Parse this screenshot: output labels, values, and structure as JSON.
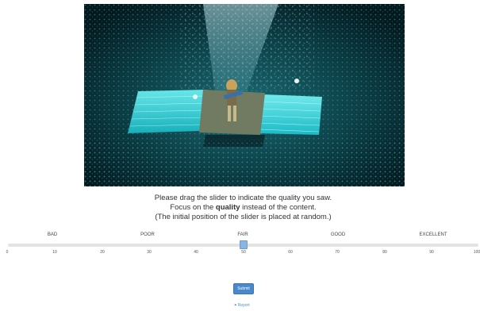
{
  "stimulus": {
    "description_icon": "concert-photo"
  },
  "instructions": {
    "line1": "Please drag the slider to indicate the quality you saw.",
    "line2_prefix": "Focus on the ",
    "line2_bold": "quality",
    "line2_suffix": " instead of the content.",
    "line3": "(The initial position of the slider is placed at random.)"
  },
  "slider": {
    "min": 0,
    "max": 100,
    "value": 50,
    "quality_labels": [
      {
        "text": "BAD",
        "value": 10
      },
      {
        "text": "POOR",
        "value": 30
      },
      {
        "text": "FAIR",
        "value": 50
      },
      {
        "text": "GOOD",
        "value": 70
      },
      {
        "text": "EXCELLENT",
        "value": 90
      }
    ],
    "ticks": [
      "0",
      "10",
      "20",
      "30",
      "40",
      "50",
      "60",
      "70",
      "80",
      "90",
      "100"
    ]
  },
  "submit": {
    "label": "Submit"
  },
  "report": {
    "label": "Report",
    "icon": "flag-icon"
  },
  "colors": {
    "accent": "#4a88cc",
    "thumb": "#8ab4e3",
    "track": "#e3e3e3"
  }
}
